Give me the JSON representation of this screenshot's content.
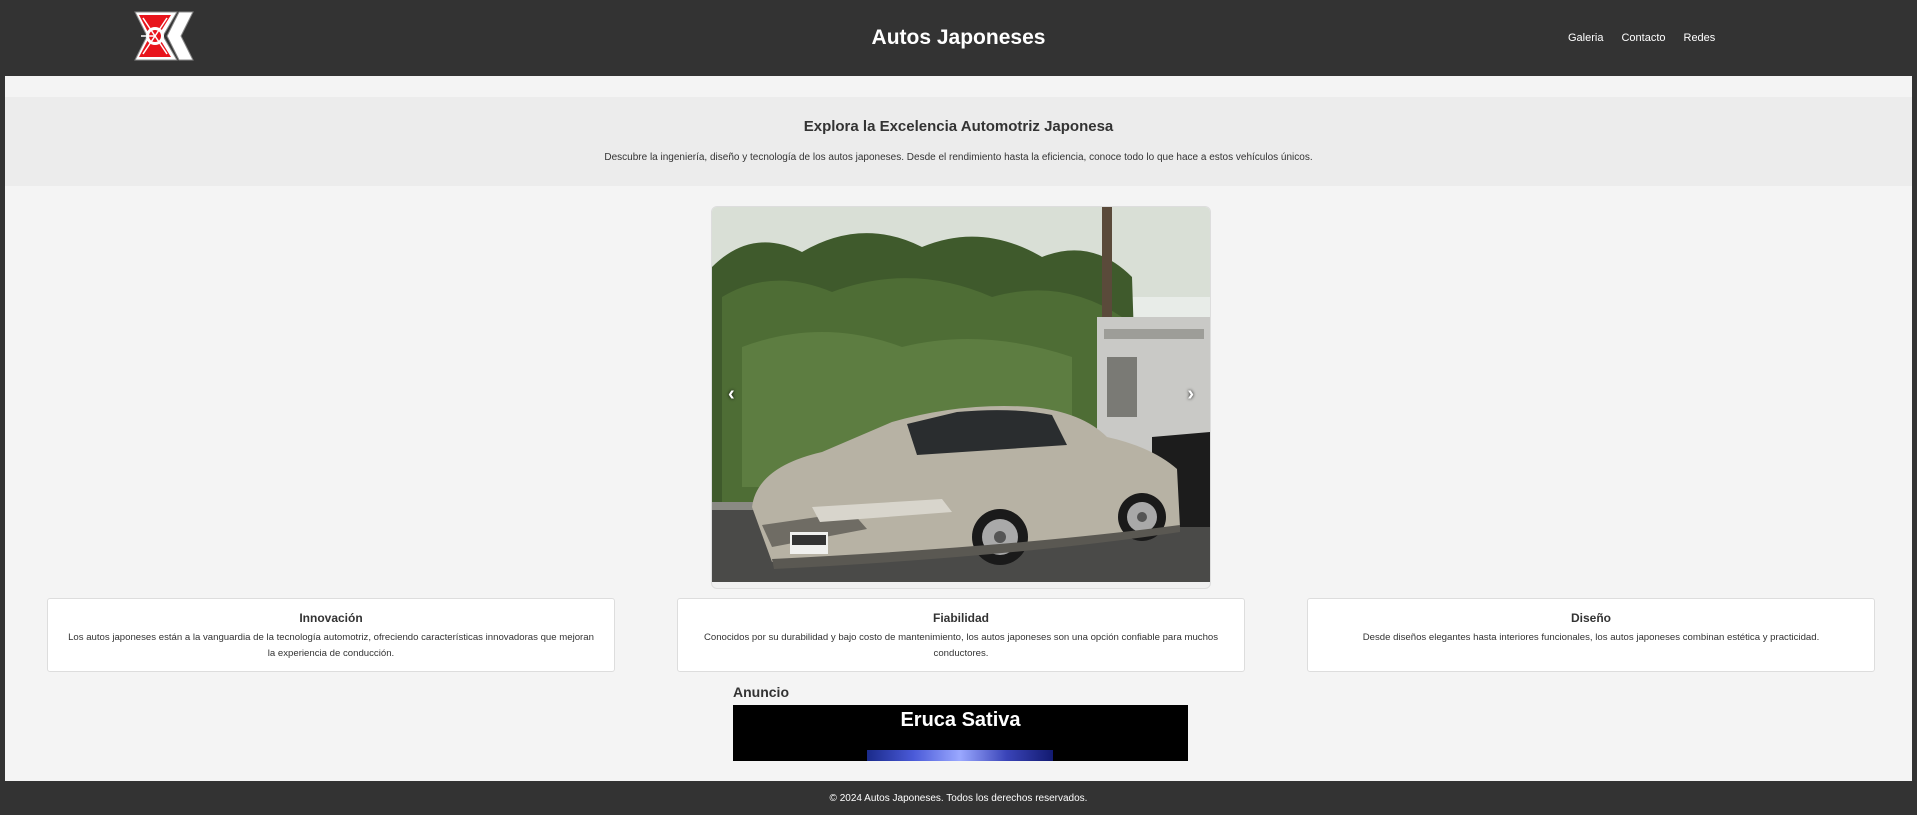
{
  "header": {
    "title": "Autos Japoneses",
    "nav": [
      "Galeria",
      "Contacto",
      "Redes"
    ]
  },
  "hero": {
    "heading": "Explora la Excelencia Automotriz Japonesa",
    "text": "Descubre la ingeniería, diseño y tecnología de los autos japoneses. Desde el rendimiento hasta la eficiencia, conoce todo lo que hace a estos vehículos únicos."
  },
  "carousel": {
    "prev": "‹",
    "next": "›"
  },
  "features": [
    {
      "title": "Innovación",
      "text": "Los autos japoneses están a la vanguardia de la tecnología automotriz, ofreciendo características innovadoras que mejoran la experiencia de conducción."
    },
    {
      "title": "Fiabilidad",
      "text": "Conocidos por su durabilidad y bajo costo de mantenimiento, los autos japoneses son una opción confiable para muchos conductores."
    },
    {
      "title": "Diseño",
      "text": "Desde diseños elegantes hasta interiores funcionales, los autos japoneses combinan estética y practicidad."
    }
  ],
  "ad": {
    "heading": "Anuncio",
    "name": "Eruca Sativa"
  },
  "footer": {
    "text": "© 2024 Autos Japoneses. Todos los derechos reservados."
  },
  "colors": {
    "header_bg": "#333333",
    "page_bg": "#f4f4f4",
    "hero_bg": "#ececec",
    "logo_red": "#e8141c"
  }
}
